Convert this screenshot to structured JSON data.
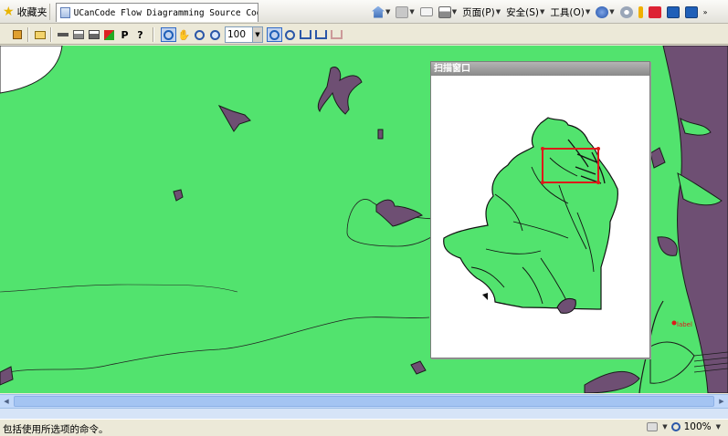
{
  "browser": {
    "favorites_label": "收藏夹",
    "tab_title": "UCanCode Flow Diagramming Source Code Kit",
    "commands": {
      "page": "页面(P)",
      "safety": "安全(S)",
      "tools": "工具(O)"
    }
  },
  "toolbar": {
    "print_label": "P",
    "help_label": "?",
    "zoom_value": "100"
  },
  "scan_window": {
    "title": "扫描窗口"
  },
  "map": {
    "marker_label": "label"
  },
  "status": {
    "text": "包括使用所选项的命令。",
    "zoom": "100%"
  },
  "colors": {
    "land": "#52e36e",
    "water": "#6e4f73",
    "selection": "#dd1a1a",
    "panel_title": "#9a9a9a"
  },
  "icons": [
    "star-icon",
    "home-icon",
    "feed-icon",
    "mail-icon",
    "print-icon",
    "help-circle-icon",
    "gear-icon",
    "zoom-in-icon",
    "zoom-out-icon",
    "pan-hand-icon",
    "select-icon"
  ]
}
